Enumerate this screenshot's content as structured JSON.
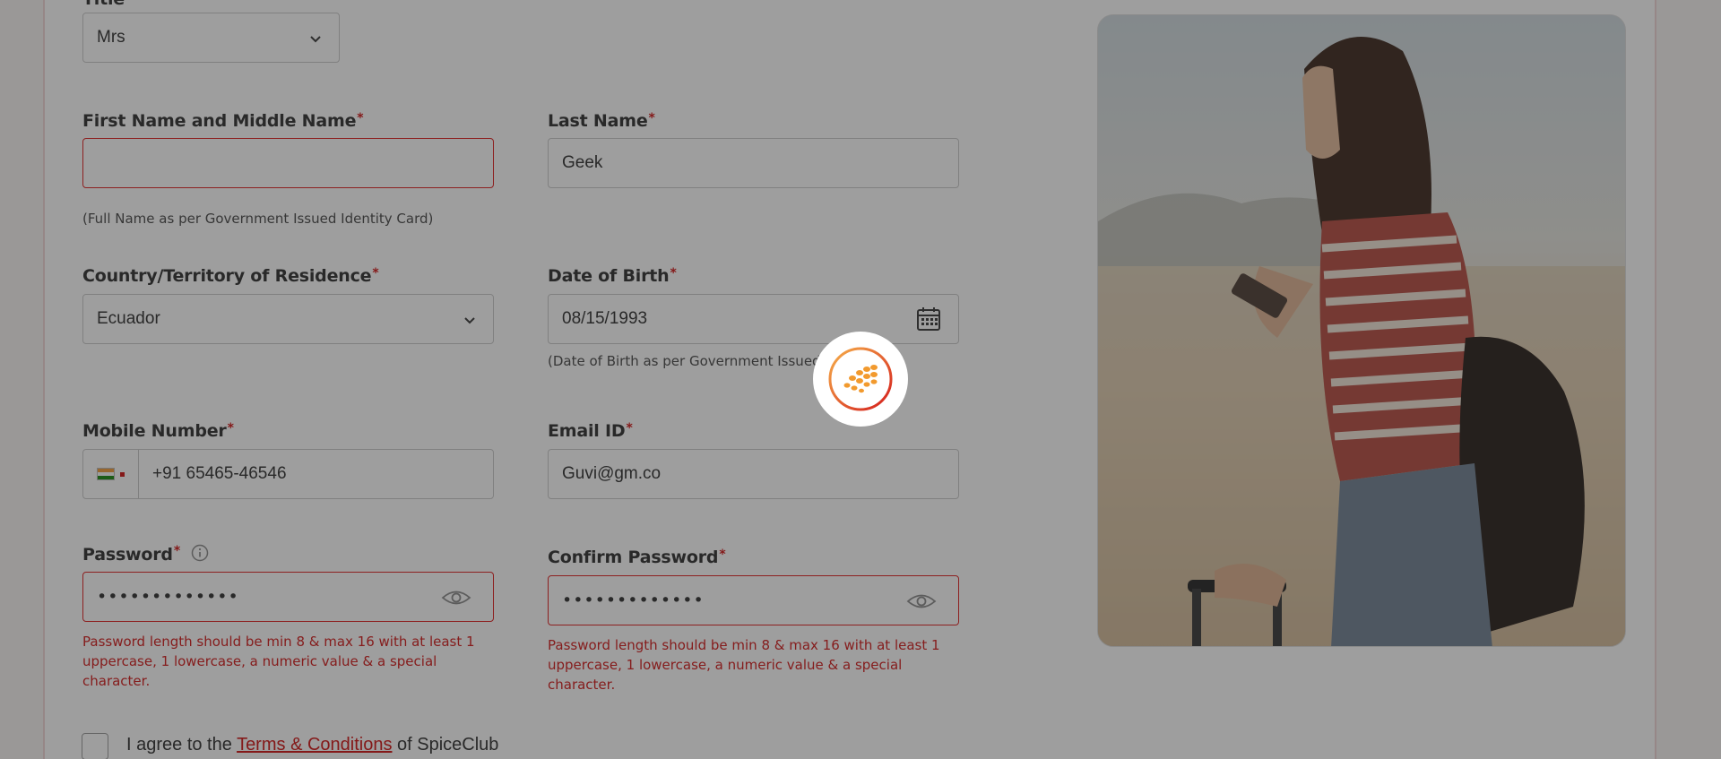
{
  "form": {
    "title_label": "Title",
    "title_value": "Mrs",
    "first_name_label": "First Name and Middle Name",
    "first_name_value": "",
    "first_name_hint": "(Full Name as per Government Issued Identity Card)",
    "last_name_label": "Last Name",
    "last_name_value": "Geek",
    "country_label": "Country/Territory of Residence",
    "country_value": "Ecuador",
    "dob_label": "Date of Birth",
    "dob_value": "08/15/1993",
    "dob_hint": "(Date of Birth as per Government Issued ID)",
    "mobile_label": "Mobile Number",
    "mobile_value": "+91 65465-46546",
    "email_label": "Email ID",
    "email_value": "Guvi@gm.co",
    "password_label": "Password",
    "password_value": "•••••••••••••",
    "password_error": "Password length should be min 8 & max 16 with at least 1 uppercase, 1 lowercase, a numeric value & a special character.",
    "confirm_password_label": "Confirm Password",
    "confirm_password_value": "•••••••••••••",
    "confirm_password_error": "Password length should be min 8 & max 16 with at least 1 uppercase, 1 lowercase, a numeric value & a special character.",
    "required_mark": "*",
    "agree_prefix": "I agree to the ",
    "agree_link": "Terms & Conditions",
    "agree_suffix": " of SpiceClub"
  },
  "colors": {
    "accent": "#d00d0d",
    "overlay": "#282828",
    "loader_orange": "#f29a2e"
  },
  "icons": {
    "chevron": "chevron-down-icon",
    "calendar": "calendar-icon",
    "eye": "eye-icon",
    "info": "info-icon",
    "flag": "india-flag-icon",
    "loader": "spiceclub-loader-icon"
  }
}
